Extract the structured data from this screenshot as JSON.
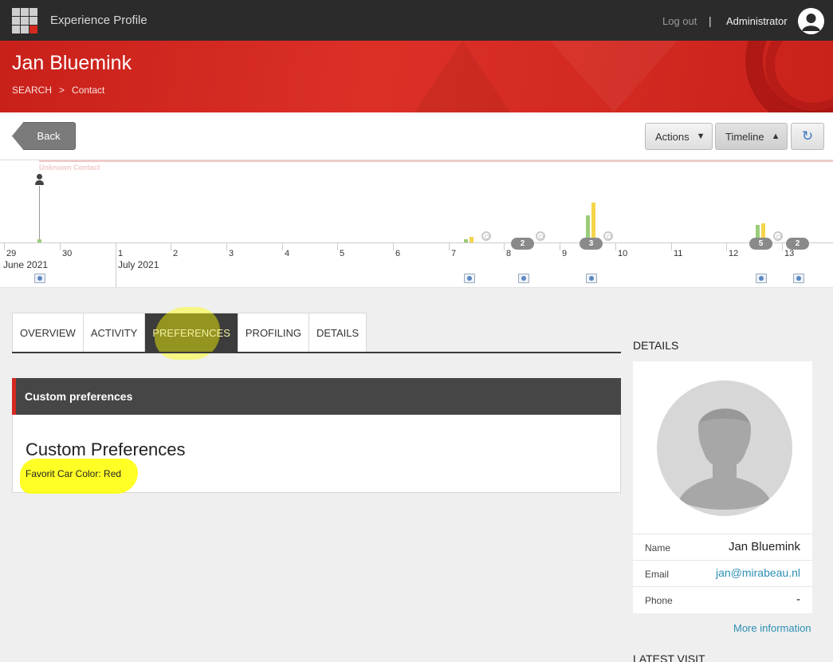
{
  "topbar": {
    "app_title": "Experience Profile",
    "logout": "Log out",
    "separator": "|",
    "user": "Administrator"
  },
  "header": {
    "contact_name": "Jan Bluemink",
    "breadcrumb": [
      "SEARCH",
      "Contact"
    ],
    "breadcrumb_sep": ">"
  },
  "toolbar": {
    "back": "Back",
    "actions": "Actions",
    "actions_arrow": "▼",
    "timeline": "Timeline",
    "timeline_arrow": "▲",
    "refresh_icon": "↻"
  },
  "timeline": {
    "unknown_label": "Unknown Contact",
    "day_ticks": [
      "29",
      "30",
      "1",
      "2",
      "3",
      "4",
      "5",
      "6",
      "7",
      "8",
      "9",
      "10",
      "11",
      "12",
      "13"
    ],
    "months": [
      "June 2021",
      "July 2021"
    ],
    "counts": [
      "2",
      "3",
      "5",
      "2"
    ]
  },
  "tabs": [
    {
      "label": "OVERVIEW"
    },
    {
      "label": "ACTIVITY"
    },
    {
      "label": "PREFERENCES"
    },
    {
      "label": "PROFILING"
    },
    {
      "label": "DETAILS"
    }
  ],
  "panel": {
    "header": "Custom preferences",
    "title": "Custom Preferences",
    "line": "Favorit Car Color: Red"
  },
  "details": {
    "label": "DETAILS",
    "name_key": "Name",
    "name_val": "Jan Bluemink",
    "email_key": "Email",
    "email_val": "jan@mirabeau.nl",
    "phone_key": "Phone",
    "phone_val": "-",
    "more": "More information",
    "latest_visit": "LATEST VISIT"
  },
  "colors": {
    "accent_red": "#d4281f",
    "topbar": "#2b2b2b",
    "link": "#2e8fb4",
    "highlight": "#ffff00"
  }
}
